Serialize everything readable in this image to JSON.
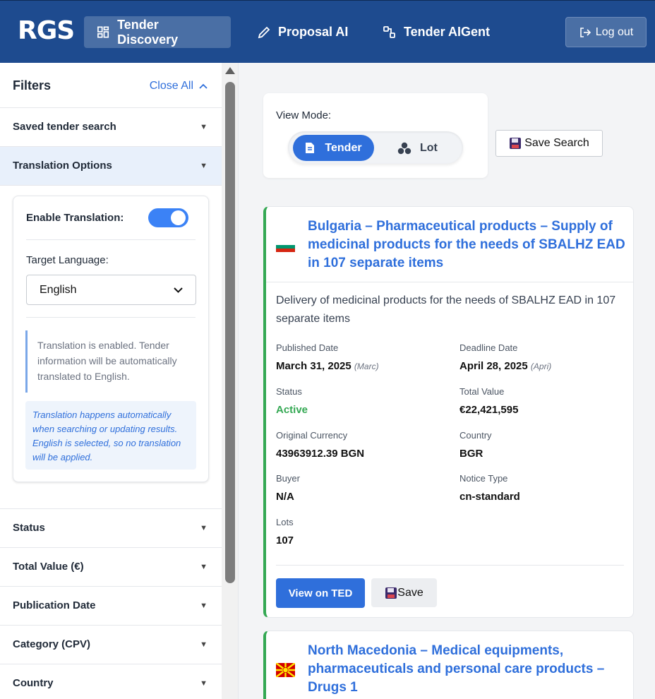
{
  "header": {
    "logo": "RGS",
    "nav": [
      {
        "label": "Tender Discovery",
        "icon": "grid-icon",
        "active": true
      },
      {
        "label": "Proposal AI",
        "icon": "pencil-icon",
        "active": false
      },
      {
        "label": "Tender AIGent",
        "icon": "nodes-icon",
        "active": false
      }
    ],
    "logout_label": "Log out"
  },
  "sidebar": {
    "title": "Filters",
    "close_all": "Close All",
    "sections": [
      {
        "label": "Saved tender search"
      },
      {
        "label": "Translation Options"
      },
      {
        "label": "Status"
      },
      {
        "label": "Total Value (€)"
      },
      {
        "label": "Publication Date"
      },
      {
        "label": "Category (CPV)"
      },
      {
        "label": "Country"
      }
    ],
    "translation": {
      "enable_label": "Enable Translation:",
      "enabled": true,
      "target_label": "Target Language:",
      "target_value": "English",
      "info": "Translation is enabled. Tender information will be automatically translated to English.",
      "note": "Translation happens automatically when searching or updating results. English is selected, so no translation will be applied."
    }
  },
  "main": {
    "view_mode_label": "View Mode:",
    "view_tender": "Tender",
    "view_lot": "Lot",
    "save_search": "Save Search",
    "cards": [
      {
        "title": "Bulgaria – Pharmaceutical products – Supply of medicinal products for the needs of SBALHZ EAD in 107 separate items",
        "description": "Delivery of medicinal products for the needs of SBALHZ EAD in 107 separate items",
        "published_label": "Published Date",
        "published_value": "March 31, 2025",
        "published_sub": "(Marc)",
        "deadline_label": "Deadline Date",
        "deadline_value": "April 28, 2025",
        "deadline_sub": "(Apri)",
        "status_label": "Status",
        "status_value": "Active",
        "total_label": "Total Value",
        "total_value": "€22,421,595",
        "currency_label": "Original Currency",
        "currency_value": "43963912.39 BGN",
        "country_label": "Country",
        "country_value": "BGR",
        "buyer_label": "Buyer",
        "buyer_value": "N/A",
        "notice_label": "Notice Type",
        "notice_value": "cn-standard",
        "lots_label": "Lots",
        "lots_value": "107",
        "btn_ted": "View on TED",
        "btn_save": "Save"
      },
      {
        "title": "North Macedonia – Medical equipments, pharmaceuticals and personal care products – Drugs 1"
      }
    ]
  },
  "colors": {
    "header": "#1e4b8f",
    "accent": "#2f6fdb",
    "active_status": "#34a853"
  }
}
